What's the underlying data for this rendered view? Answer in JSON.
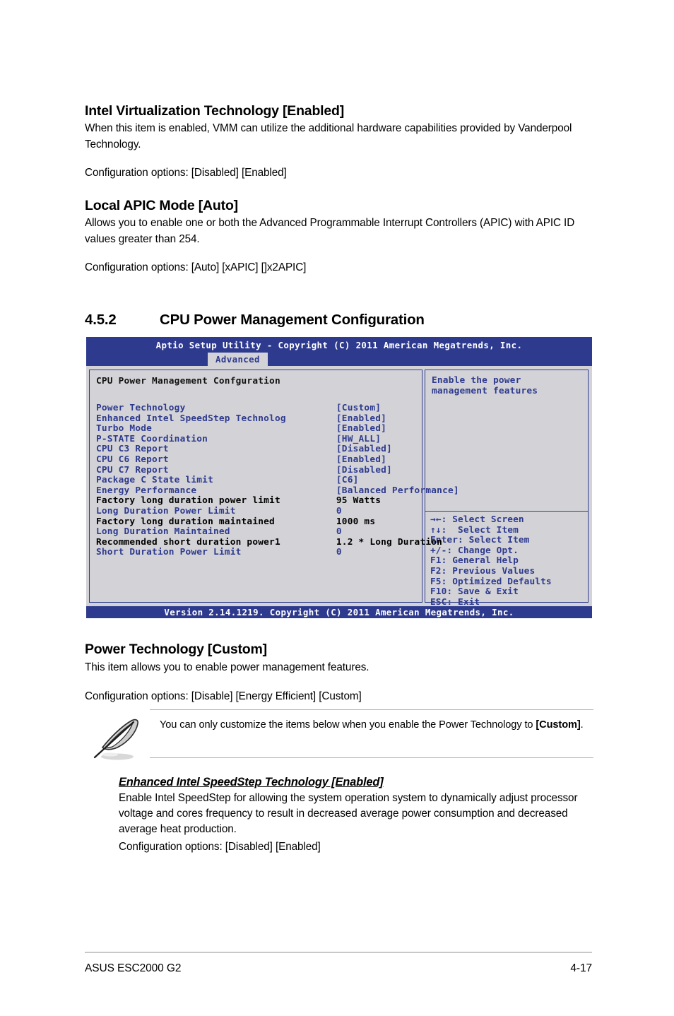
{
  "document": {
    "footer_left": "ASUS ESC2000 G2",
    "footer_page": "4-17"
  },
  "virtualization": {
    "heading": "Intel Virtualization Technology [Enabled]",
    "body": "When this item is enabled, VMM can utilize the additional hardware capabilities provided by Vanderpool Technology.",
    "options": "Configuration options: [Disabled] [Enabled]"
  },
  "apic": {
    "heading": "Local APIC Mode [Auto]",
    "body": "Allows you to enable one or both the Advanced Programmable Interrupt Controllers (APIC) with APIC ID values greater  than 254.",
    "options": "Configuration options: [Auto] [xAPIC] []x2APIC]"
  },
  "section": {
    "number": "4.5.2",
    "title": "CPU Power Management Configuration"
  },
  "bios": {
    "titlebar": "Aptio Setup Utility - Copyright (C) 2011 American Megatrends, Inc.",
    "active_tab": "Advanced",
    "panel_title": "CPU Power Management Confguration",
    "footer": "Version 2.14.1219. Copyright (C) 2011 American Megatrends, Inc.",
    "help_text": "Enable the power\nmanagement features",
    "colors": {
      "header_blue": "#2e3a8e",
      "body_gray": "#d3d3d7",
      "option_blue": "#2e3a8e",
      "info_black": "#000000"
    },
    "items": [
      {
        "label": "Power Technology",
        "value": "[Custom]",
        "kind": "option"
      },
      {
        "label": "Enhanced Intel SpeedStep Technolog",
        "value": "[Enabled]",
        "kind": "option"
      },
      {
        "label": "Turbo Mode",
        "value": "[Enabled]",
        "kind": "option"
      },
      {
        "label": "P-STATE Coordination",
        "value": "[HW_ALL]",
        "kind": "option"
      },
      {
        "label": "CPU C3 Report",
        "value": "[Disabled]",
        "kind": "option"
      },
      {
        "label": "CPU C6 Report",
        "value": "[Enabled]",
        "kind": "option"
      },
      {
        "label": "CPU C7 Report",
        "value": "[Disabled]",
        "kind": "option"
      },
      {
        "label": "Package C State limit",
        "value": "[C6]",
        "kind": "option"
      },
      {
        "label": "Energy Performance",
        "value": "[Balanced Performance]",
        "kind": "option"
      },
      {
        "label": "Factory long duration power limit",
        "value": "95 Watts",
        "kind": "info"
      },
      {
        "label": "Long Duration Power Limit",
        "value": "0",
        "kind": "option"
      },
      {
        "label": "Factory long duration maintained",
        "value": "1000 ms",
        "kind": "info"
      },
      {
        "label": "Long Duration Maintained",
        "value": "0",
        "kind": "option"
      },
      {
        "label": "Recommended short duration power1",
        "value": "1.2 * Long Duration",
        "kind": "info"
      },
      {
        "label": "Short Duration Power Limit",
        "value": "0",
        "kind": "option"
      }
    ],
    "nav_keys": [
      "→←: Select Screen",
      "↑↓:  Select Item",
      "Enter: Select Item",
      "+/-: Change Opt.",
      "F1: General Help",
      "F2: Previous Values",
      "F5: Optimized Defaults",
      "F10: Save & Exit",
      "ESC: Exit"
    ]
  },
  "power_technology": {
    "heading": "Power Technology [Custom]",
    "body": "This item allows you to enable power management features.",
    "options": "Configuration options: [Disable] [Energy Efficient] [Custom]"
  },
  "note": {
    "text_before": "You can only customize the items below when you enable the Power Technology to ",
    "text_bold": "[Custom]",
    "text_after": "."
  },
  "speedstep": {
    "heading": "Enhanced Intel SpeedStep Technology [Enabled]",
    "body": "Enable Intel SpeedStep for allowing the system operation system to dynamically adjust processor voltage and cores frequency to result in decreased average power consumption and decreased average heat production.",
    "options": "Configuration options: [Disabled] [Enabled]"
  }
}
